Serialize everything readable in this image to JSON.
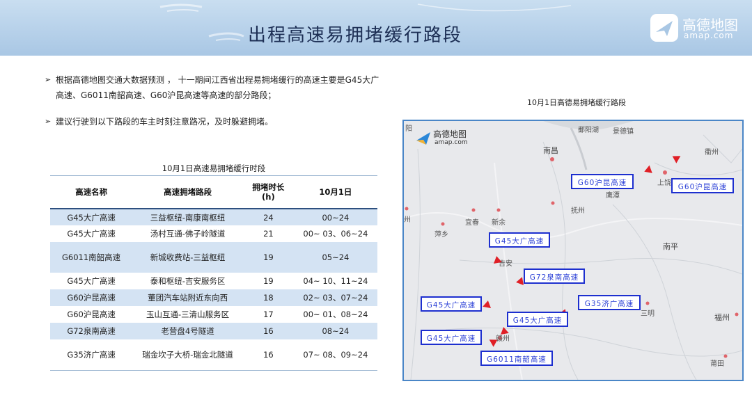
{
  "header": {
    "title": "出程高速易拥堵缓行路段",
    "brand_name": "高德地图",
    "brand_site": "amap.com"
  },
  "bullets": [
    "根据高德地图交通大数据预测 ， 十一期间江西省出程易拥堵缓行的高速主要是G45大广高速、G6011南韶高速、G60沪昆高速等高速的部分路段；",
    "建议行驶到以下路段的车主时刻注意路况，及时躲避拥堵。"
  ],
  "table": {
    "title": "10月1日高速易拥堵缓行时段",
    "headers": [
      "高速名称",
      "高速拥堵路段",
      "拥堵时长\n(h)",
      "10月1日"
    ],
    "rows": [
      [
        "G45大广高速",
        "三益枢纽-南康南枢纽",
        "24",
        "00~24"
      ],
      [
        "G45大广高速",
        "汤村互通-佛子岭隧道",
        "21",
        "00~ 03、06~24"
      ],
      [
        "G6011南韶高速",
        "新城收费站-三益枢纽",
        "19",
        "05~24"
      ],
      [
        "G45大广高速",
        "泰和枢纽-吉安服务区",
        "19",
        "04~ 10、11~24"
      ],
      [
        "G60沪昆高速",
        "董团汽车站附近东向西",
        "18",
        "02~ 03、07~24"
      ],
      [
        "G60沪昆高速",
        "玉山互通-三清山服务区",
        "17",
        "00~ 01、08~24"
      ],
      [
        "G72泉南高速",
        "老营盘4号隧道",
        "16",
        "08~24"
      ],
      [
        "G35济广高速",
        "瑞金坎子大桥-瑞金北隧道",
        "16",
        "07~ 08、09~24"
      ]
    ]
  },
  "map": {
    "title": "10月1日高德易拥堵缓行路段",
    "logo_name": "高德地图",
    "logo_site": "amap.com",
    "places": [
      "阳",
      "鄱阳湖",
      "景德镇",
      "南昌",
      "衢州",
      "上饶",
      "抚州",
      "鹰潭",
      "州",
      "宜春",
      "新余",
      "萍乡",
      "南平",
      "吉安",
      "三明",
      "福州",
      "赣州",
      "莆田"
    ],
    "roads": [
      "G60沪昆高速",
      "G60沪昆高速",
      "G45大广高速",
      "G72泉南高速",
      "G35济广高速",
      "G45大广高速",
      "G45大广高速",
      "G45大广高速",
      "G6011南韶高速"
    ],
    "flag_color": "#e01f26",
    "road_color": "#1d2fcf"
  }
}
